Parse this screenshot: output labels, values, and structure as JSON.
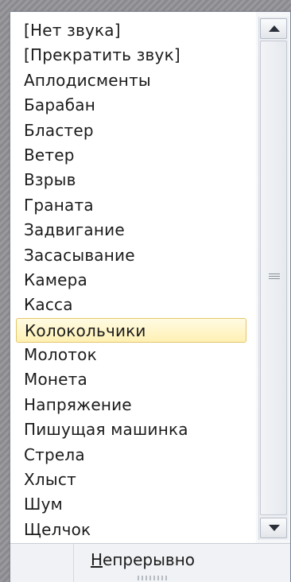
{
  "sound_list": {
    "items": [
      "[Нет звука]",
      "[Прекратить звук]",
      "Аплодисменты",
      "Барабан",
      "Бластер",
      "Ветер",
      "Взрыв",
      "Граната",
      "Задвигание",
      "Засасывание",
      "Камера",
      "Касса",
      "Колокольчики",
      "Молоток",
      "Монета",
      "Напряжение",
      "Пишущая машинка",
      "Стрела",
      "Хлыст",
      "Шум",
      "Щелчок"
    ],
    "selected": "Колокольчики"
  },
  "footer": {
    "continuous_mnemonic": "Н",
    "continuous_rest": "епрерывно"
  },
  "icons": {
    "scroll_up": "triangle-up-icon",
    "scroll_down": "triangle-down-icon",
    "grip": "scroll-thumb-grip-icon"
  },
  "colors": {
    "selection_fill": "#fff3c0",
    "selection_border": "#e3c66a"
  }
}
